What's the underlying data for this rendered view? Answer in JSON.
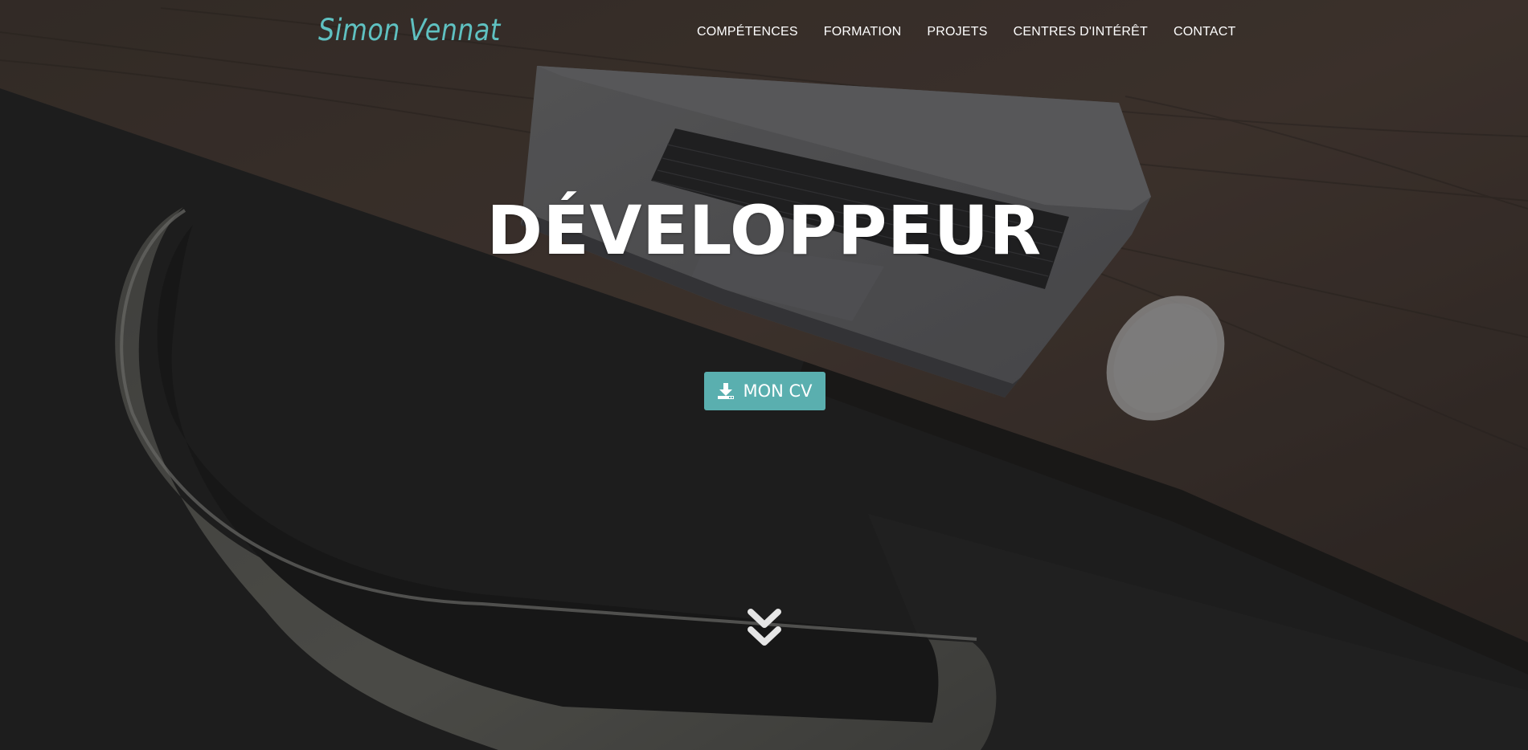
{
  "brand": {
    "name": "Simon Vennat",
    "color": "#5fc1c1"
  },
  "nav": {
    "items": [
      {
        "label": "COMPÉTENCES"
      },
      {
        "label": "FORMATION"
      },
      {
        "label": "PROJETS"
      },
      {
        "label": "CENTRES D'INTÉRÊT"
      },
      {
        "label": "CONTACT"
      }
    ]
  },
  "hero": {
    "headline": "DÉVELOPPEUR",
    "cv_button_label": "MON CV",
    "cv_button_icon": "download-icon",
    "cv_button_color": "#5aafaf",
    "scroll_icon": "double-chevron-down-icon"
  }
}
